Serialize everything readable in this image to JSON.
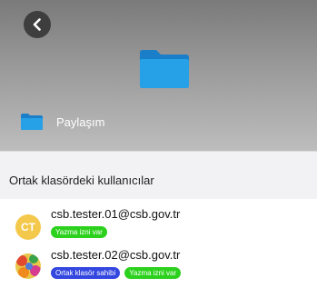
{
  "header": {
    "folder_name": "Paylaşım"
  },
  "section": {
    "title": "Ortak klasördeki kullanıcılar"
  },
  "users": [
    {
      "avatar_initials": "CT",
      "email": "csb.tester.01@csb.gov.tr",
      "badges": [
        "Yazma izni var"
      ]
    },
    {
      "avatar_initials": "",
      "email": "csb.tester.02@csb.gov.tr",
      "badges": [
        "Ortak klasör sahibi",
        "Yazma izni var"
      ]
    }
  ],
  "colors": {
    "folder_blue": "#1f8ed6",
    "badge_green": "#2cd11d",
    "badge_blue": "#3346e0",
    "avatar_yellow": "#f4c84a"
  }
}
